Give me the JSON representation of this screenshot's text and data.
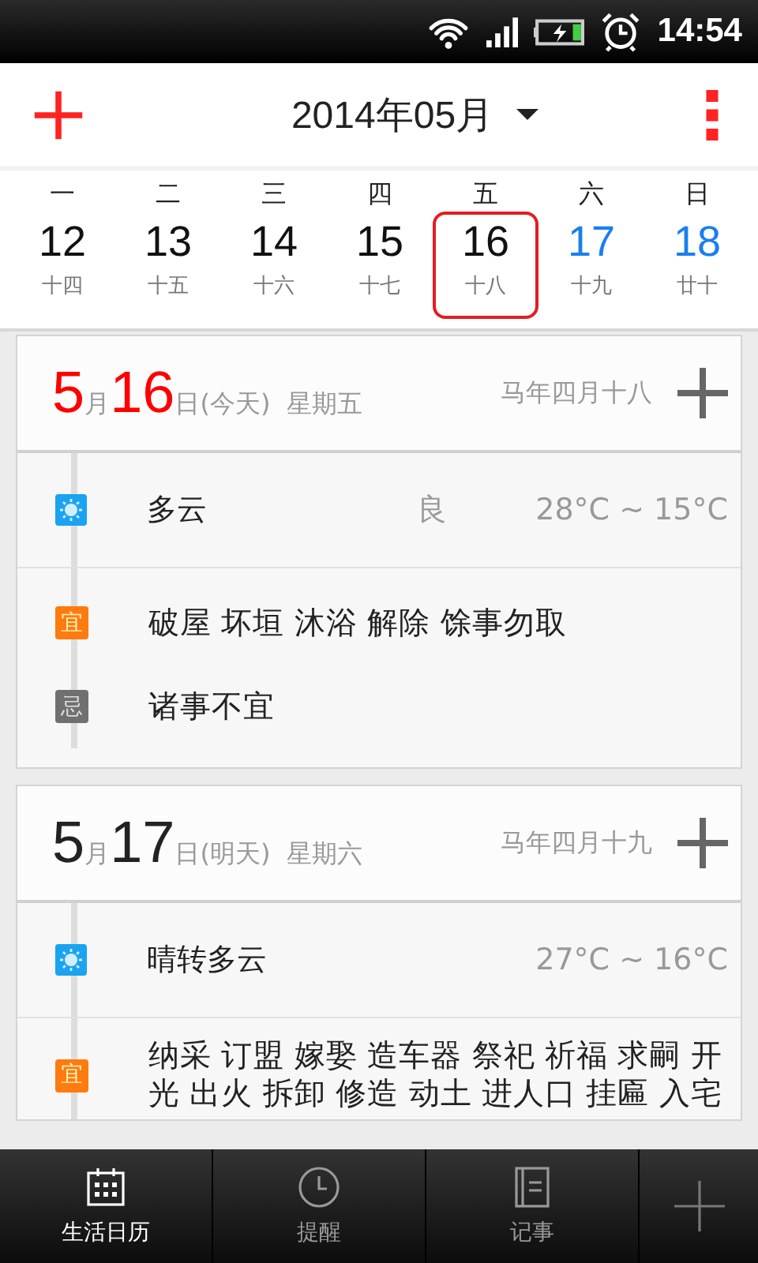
{
  "status_bar": {
    "time": "14:54"
  },
  "header": {
    "title": "2014年05月"
  },
  "week": [
    {
      "weekday": "一",
      "day": "12",
      "lunar": "十四",
      "weekend": false,
      "selected": false
    },
    {
      "weekday": "二",
      "day": "13",
      "lunar": "十五",
      "weekend": false,
      "selected": false
    },
    {
      "weekday": "三",
      "day": "14",
      "lunar": "十六",
      "weekend": false,
      "selected": false
    },
    {
      "weekday": "四",
      "day": "15",
      "lunar": "十七",
      "weekend": false,
      "selected": false
    },
    {
      "weekday": "五",
      "day": "16",
      "lunar": "十八",
      "weekend": false,
      "selected": true
    },
    {
      "weekday": "六",
      "day": "17",
      "lunar": "十九",
      "weekend": true,
      "selected": false
    },
    {
      "weekday": "日",
      "day": "18",
      "lunar": "廿十",
      "weekend": true,
      "selected": false
    }
  ],
  "days": [
    {
      "month": "5",
      "month_unit": "月",
      "day": "16",
      "suffix": "日(今天)  星期五",
      "lunar": "马年四月十八",
      "today": true,
      "rows": [
        {
          "kind": "weather",
          "text": "多云",
          "air": "良",
          "temp": "28°C ~ 15°C"
        },
        {
          "kind": "yi",
          "badge": "宜",
          "lines": [
            "破屋 坏垣 沐浴 解除 馀事勿取"
          ]
        },
        {
          "kind": "ji",
          "badge": "忌",
          "lines": [
            "诸事不宜"
          ]
        }
      ]
    },
    {
      "month": "5",
      "month_unit": "月",
      "day": "17",
      "suffix": "日(明天)  星期六",
      "lunar": "马年四月十九",
      "today": false,
      "rows": [
        {
          "kind": "weather",
          "text": "晴转多云",
          "temp": "27°C ~ 16°C"
        },
        {
          "kind": "yi",
          "badge": "宜",
          "lines": [
            "纳采 订盟 嫁娶 造车器 祭祀 祈福 求嗣 开",
            "光 出火 拆卸 修造 动土 进人口 挂匾 入宅"
          ]
        }
      ]
    }
  ],
  "tabs": [
    {
      "label": "生活日历",
      "selected": true
    },
    {
      "label": "提醒",
      "selected": false
    },
    {
      "label": "记事",
      "selected": false
    }
  ]
}
